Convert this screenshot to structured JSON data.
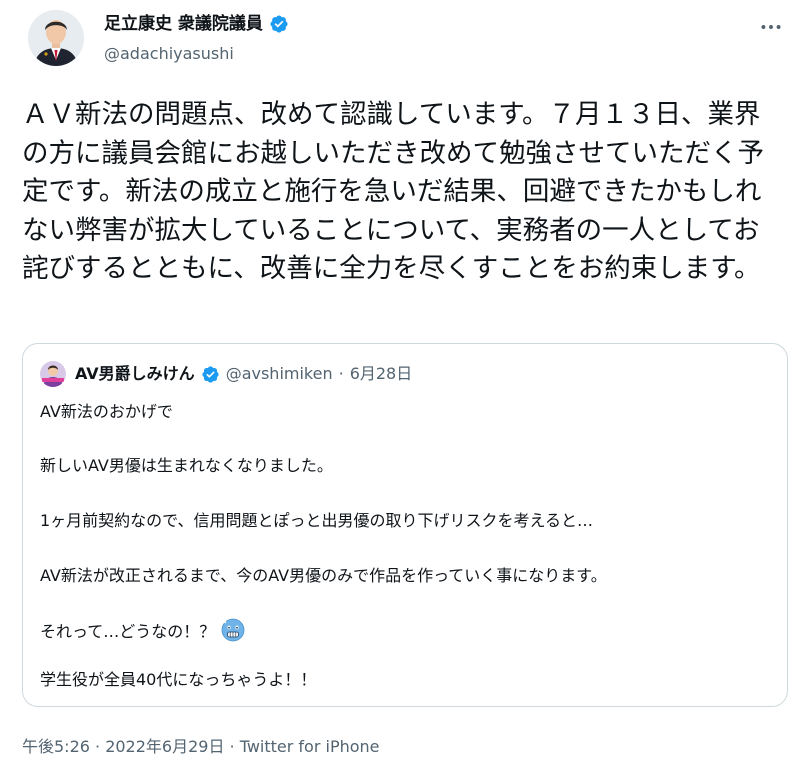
{
  "author": {
    "name": "足立康史 衆議院議員",
    "handle": "@adachiyasushi",
    "verified_icon": "verified-badge-icon",
    "accent_color": "#1d9bf0"
  },
  "tweet": {
    "text": "ＡＶ新法の問題点、改めて認識しています。７月１３日、業界の方に議員会館にお越しいただき改めて勉強させていただく予定です。新法の成立と施行を急いだ結果、回避できたかもしれない弊害が拡大していることについて、実務者の一人としてお詫びするとともに、改善に全力を尽くすことをお約束します。"
  },
  "quote": {
    "name": "AV男爵しみけん",
    "handle": "@avshimiken",
    "separator": "·",
    "date": "6月28日",
    "lines": [
      "AV新法のおかげで",
      "新しいAV男優は生まれなくなりました。",
      "1ヶ月前契約なので、信用問題とぽっと出男優の取り下げリスクを考えると…",
      "AV新法が改正されるまで、今のAV男優のみで作品を作っていく事になります。",
      "それって…どうなの！？",
      "学生役が全員40代になっちゃうよ！！"
    ],
    "emoji": "cold-face-emoji"
  },
  "meta": {
    "timestamp": "午後5:26 · 2022年6月29日 · Twitter for iPhone"
  }
}
